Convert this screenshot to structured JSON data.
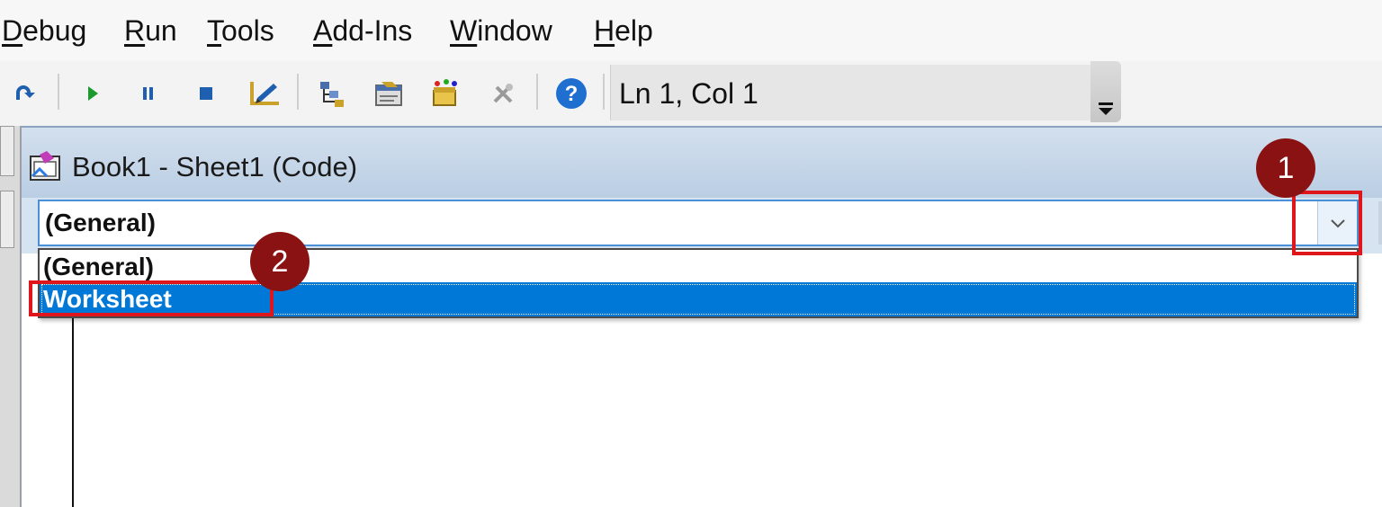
{
  "menu": {
    "items": [
      {
        "accel": "D",
        "rest": "ebug"
      },
      {
        "accel": "R",
        "rest": "un"
      },
      {
        "accel": "T",
        "rest": "ools"
      },
      {
        "accel": "A",
        "rest": "dd-Ins"
      },
      {
        "accel": "W",
        "rest": "indow"
      },
      {
        "accel": "H",
        "rest": "elp"
      }
    ]
  },
  "toolbar": {
    "position_text": "Ln 1, Col 1",
    "icons": [
      "redo-icon",
      "run-icon",
      "break-icon",
      "reset-icon",
      "design-mode-icon",
      "project-explorer-icon",
      "properties-window-icon",
      "object-browser-icon",
      "toolbox-icon",
      "help-icon"
    ]
  },
  "code_window": {
    "title": "Book1 - Sheet1 (Code)",
    "object_combo_value": "(General)",
    "dropdown_options": [
      "(General)",
      "Worksheet"
    ],
    "selected_option": "Worksheet"
  },
  "annotations": {
    "badge1": "1",
    "badge2": "2",
    "accent": "#8b1212",
    "highlight": "#e0161d"
  },
  "colors": {
    "selection": "#0078d7",
    "titlebar": "#c6d6e8"
  }
}
